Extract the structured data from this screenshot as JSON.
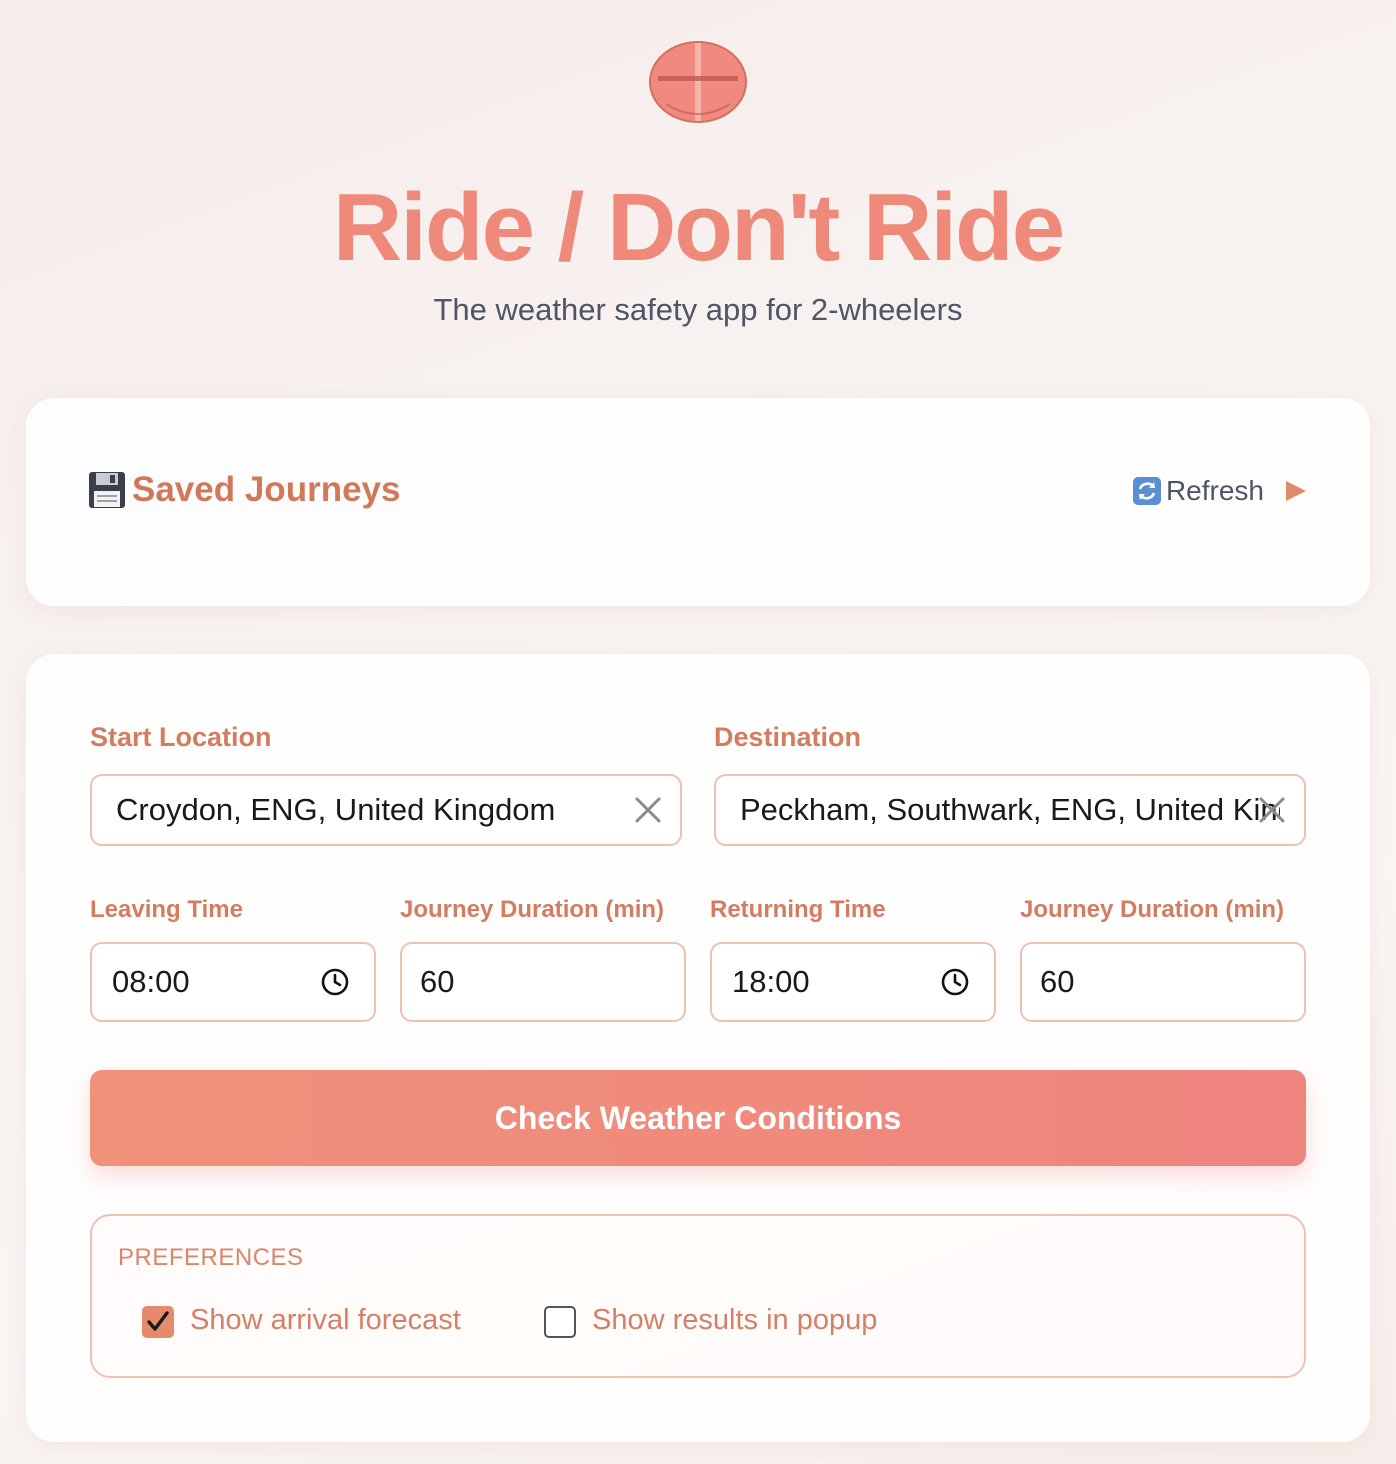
{
  "header": {
    "title": "Ride / Don't Ride",
    "subtitle": "The weather safety app for 2-wheelers",
    "logo_icon": "helmet-icon"
  },
  "saved_journeys": {
    "title": "Saved Journeys",
    "icon": "floppy-disk-icon",
    "refresh_label": "Refresh",
    "refresh_icon": "refresh-icon",
    "expand_icon": "play-arrow-icon"
  },
  "form": {
    "start_label": "Start Location",
    "start_value": "Croydon, ENG, United Kingdom",
    "destination_label": "Destination",
    "destination_value": "Peckham, Southwark, ENG, United Kingdom",
    "leaving_time_label": "Leaving Time",
    "leaving_time_value": "08:00",
    "leaving_duration_label": "Journey Duration (min)",
    "leaving_duration_value": "60",
    "returning_time_label": "Returning Time",
    "returning_time_value": "18:00",
    "returning_duration_label": "Journey Duration (min)",
    "returning_duration_value": "60",
    "submit_label": "Check Weather Conditions"
  },
  "preferences": {
    "title": "PREFERENCES",
    "options": [
      {
        "label": "Show arrival forecast",
        "checked": true
      },
      {
        "label": "Show results in popup",
        "checked": false
      }
    ]
  },
  "colors": {
    "accent": "#ef8a7a",
    "label": "#d47c62",
    "border": "#f0bfb4"
  }
}
